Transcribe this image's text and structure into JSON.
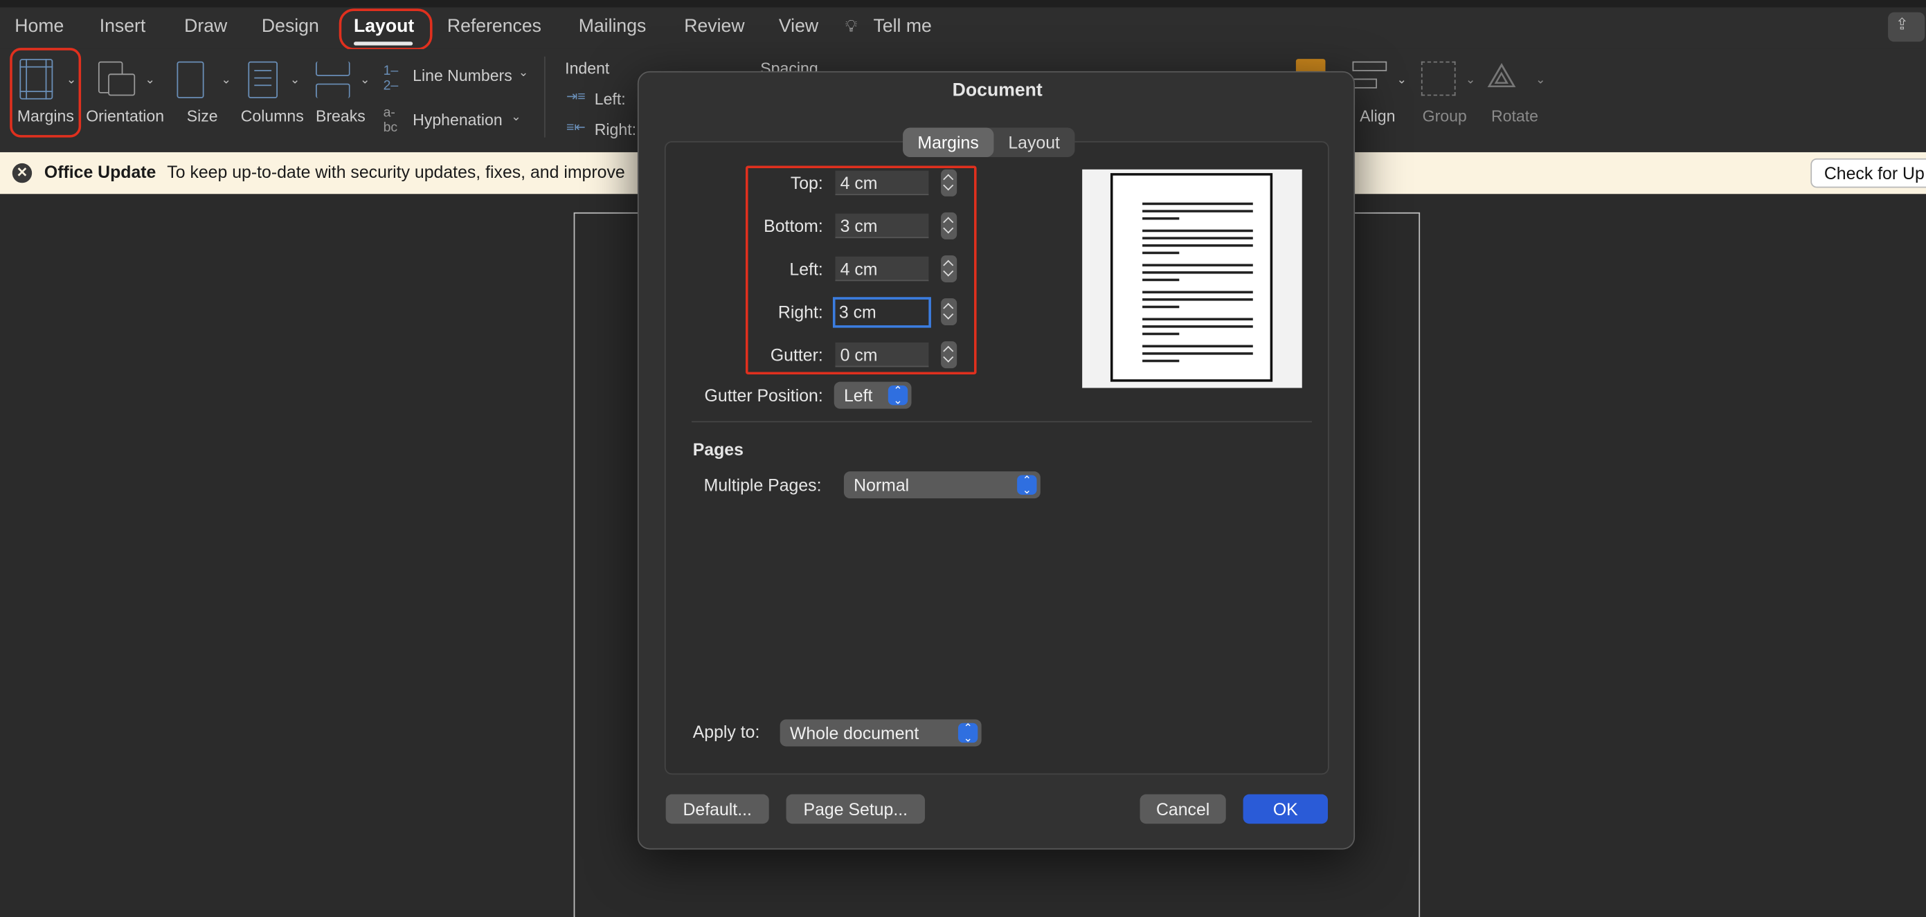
{
  "menu_tabs": [
    "Home",
    "Insert",
    "Draw",
    "Design",
    "Layout",
    "References",
    "Mailings",
    "Review",
    "View",
    "Tell me"
  ],
  "active_tab": "Layout",
  "ribbon": {
    "margins": "Margins",
    "orientation": "Orientation",
    "size": "Size",
    "columns": "Columns",
    "breaks": "Breaks",
    "line_numbers": "Line Numbers",
    "hyphenation": "Hyphenation",
    "indent": "Indent",
    "indent_left": "Left:",
    "indent_right": "Right:",
    "spacing": "Spacing",
    "align": "Align",
    "group": "Group",
    "rotate": "Rotate"
  },
  "banner": {
    "title": "Office Update",
    "message": "To keep up-to-date with security updates, fixes, and improve",
    "check_button": "Check for Up"
  },
  "dialog": {
    "title": "Document",
    "tabs": [
      "Margins",
      "Layout"
    ],
    "active_tab": "Margins",
    "margins": {
      "top_label": "Top:",
      "top_value": "4 cm",
      "bottom_label": "Bottom:",
      "bottom_value": "3 cm",
      "left_label": "Left:",
      "left_value": "4 cm",
      "right_label": "Right:",
      "right_value": "3 cm",
      "gutter_label": "Gutter:",
      "gutter_value": "0 cm"
    },
    "gutter_position_label": "Gutter Position:",
    "gutter_position_value": "Left",
    "pages_heading": "Pages",
    "multiple_pages_label": "Multiple Pages:",
    "multiple_pages_value": "Normal",
    "apply_to_label": "Apply to:",
    "apply_to_value": "Whole document",
    "buttons": {
      "default": "Default...",
      "page_setup": "Page Setup...",
      "cancel": "Cancel",
      "ok": "OK"
    }
  },
  "colors": {
    "highlight_ring": "#e0301e",
    "accent": "#2a5bd7",
    "banner_bg": "#fbf3e0"
  }
}
